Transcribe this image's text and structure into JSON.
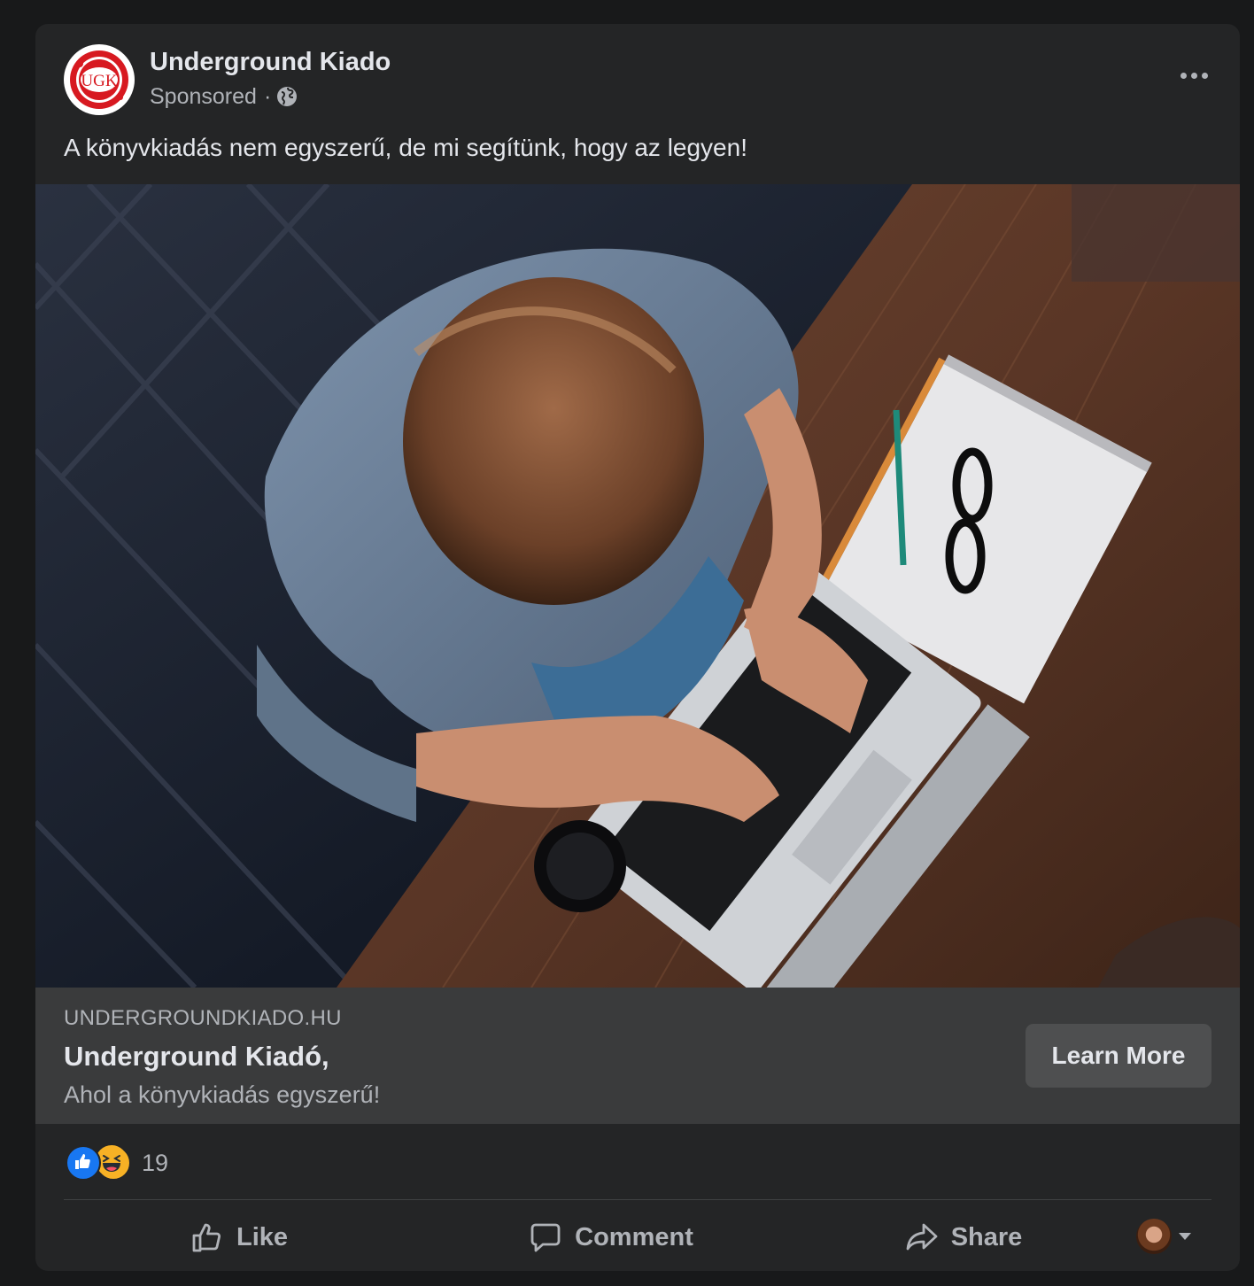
{
  "post": {
    "page_name": "Underground Kiado",
    "sponsored_label": "Sponsored",
    "separator": "·",
    "avatar_text": "UGK",
    "text": "A könyvkiadás nem egyszerű, de mi segítünk, hogy az legyen!"
  },
  "link": {
    "domain": "UNDERGROUNDKIADO.HU",
    "title": "Underground Kiadó,",
    "subtitle": "Ahol a könyvkiadás egyszerű!",
    "cta_label": "Learn More"
  },
  "reactions": {
    "count": "19",
    "types": [
      "like-icon",
      "haha-icon"
    ]
  },
  "actions": {
    "like_label": "Like",
    "comment_label": "Comment",
    "share_label": "Share"
  },
  "colors": {
    "background": "#18191a",
    "card": "#242526",
    "link_box": "#3a3b3c",
    "primary_text": "#e4e6eb",
    "secondary_text": "#b0b3b8",
    "like_blue": "#1877f2",
    "brand_red": "#d71920"
  }
}
